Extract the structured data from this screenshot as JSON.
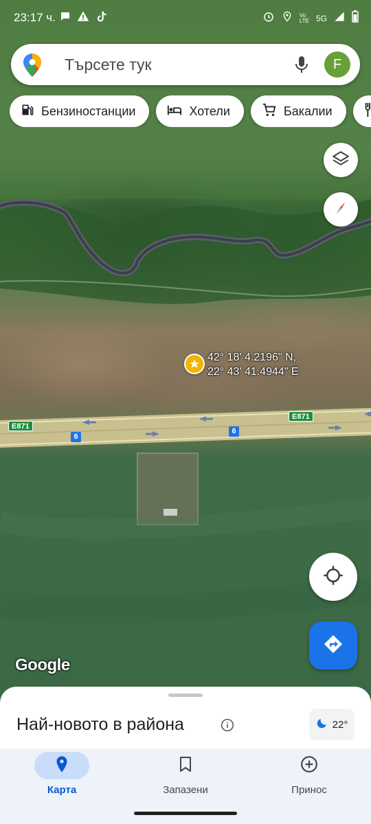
{
  "status_bar": {
    "time": "23:17 ч.",
    "network": "5G"
  },
  "search": {
    "placeholder": "Търсете тук",
    "avatar_initial": "F"
  },
  "chips": [
    {
      "icon": "gas-station-icon",
      "label": "Бензиностанции"
    },
    {
      "icon": "bed-icon",
      "label": "Хотели"
    },
    {
      "icon": "cart-icon",
      "label": "Бакалии"
    },
    {
      "icon": "restaurant-icon",
      "label": ""
    }
  ],
  "map": {
    "coord_lat": "42° 18' 4.2196\" N,",
    "coord_lon": "22° 43' 41.4944\" E",
    "road_labels": {
      "e_left": "E871",
      "e_right": "E871",
      "n_left": "6",
      "n_right": "6"
    },
    "attribution": "Google"
  },
  "sheet": {
    "title": "Най-новото в района",
    "weather": "22°"
  },
  "nav": {
    "items": [
      {
        "label": "Карта",
        "icon": "map-pin-icon",
        "active": true
      },
      {
        "label": "Запазени",
        "icon": "bookmark-icon",
        "active": false
      },
      {
        "label": "Принос",
        "icon": "add-circle-icon",
        "active": false
      }
    ]
  },
  "colors": {
    "accent": "#1a73e8",
    "pin": "#f4b400",
    "nav_active": "#0b57d0",
    "avatar": "#689f38"
  }
}
